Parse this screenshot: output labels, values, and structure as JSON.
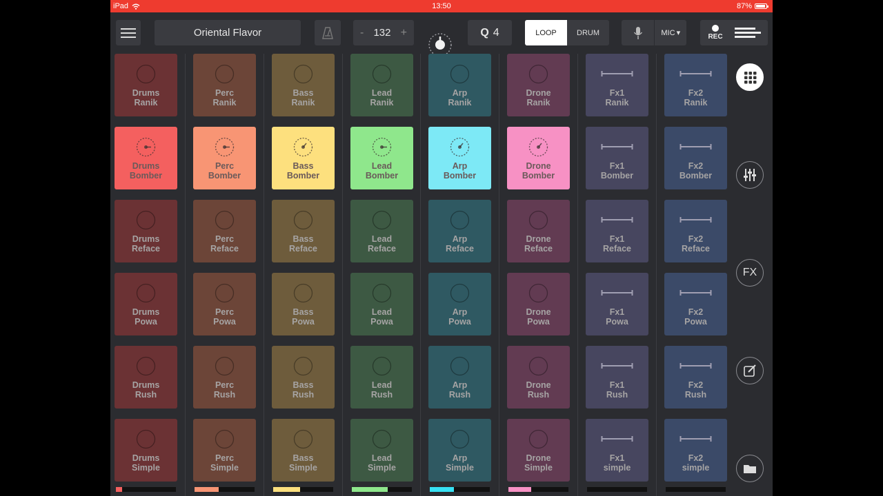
{
  "status_bar": {
    "device": "iPad",
    "time": "13:50",
    "battery": "87%"
  },
  "toolbar": {
    "project_title": "Oriental Flavor",
    "tempo": {
      "minus": "-",
      "value": "132",
      "plus": "+"
    },
    "quantize": {
      "label": "Q",
      "value": "4"
    },
    "mode": {
      "loop": "LOOP",
      "drum": "DRUM",
      "selected": "LOOP"
    },
    "input": {
      "label": "MIC",
      "arrow": "▾"
    },
    "record": {
      "label": "REC"
    }
  },
  "columns": [
    {
      "name": "Drums",
      "dim": "#6b3234",
      "active": "#f4605f",
      "level": "#f4605f",
      "level_fill": 0.1
    },
    {
      "name": "Perc",
      "dim": "#6c4538",
      "active": "#f89574",
      "level": "#f89574",
      "level_fill": 0.4
    },
    {
      "name": "Bass",
      "dim": "#6e5c3c",
      "active": "#fde07e",
      "level": "#fde07e",
      "level_fill": 0.45
    },
    {
      "name": "Lead",
      "dim": "#3d5943",
      "active": "#8fe78c",
      "level": "#8fe78c",
      "level_fill": 0.6
    },
    {
      "name": "Arp",
      "dim": "#2f5962",
      "active": "#7de9f6",
      "level": "#37e1f4",
      "level_fill": 0.4
    },
    {
      "name": "Drone",
      "dim": "#623b52",
      "active": "#f791c4",
      "level": "#f791c4",
      "level_fill": 0.38
    },
    {
      "name": "Fx1",
      "dim": "#47465f",
      "active": "#47465f",
      "level": "#555",
      "level_fill": 0
    },
    {
      "name": "Fx2",
      "dim": "#3b4a68",
      "active": "#3b4a68",
      "level": "#555",
      "level_fill": 0
    }
  ],
  "rows": [
    {
      "name": "Ranik",
      "labels": [
        "Drums\nRanik",
        "Perc\nRanik",
        "Bass\nRanik",
        "Lead\nRanik",
        "Arp\nRanik",
        "Drone\nRanik",
        "Fx1\nRanik",
        "Fx2\nRanik"
      ]
    },
    {
      "name": "Bomber",
      "active": true,
      "labels": [
        "Drums\nBomber",
        "Perc\nBomber",
        "Bass\nBomber",
        "Lead\nBomber",
        "Arp\nBomber",
        "Drone\nBomber",
        "Fx1\nBomber",
        "Fx2\nBomber"
      ]
    },
    {
      "name": "Reface",
      "labels": [
        "Drums\nReface",
        "Perc\nReface",
        "Bass\nReface",
        "Lead\nReface",
        "Arp\nReface",
        "Drone\nReface",
        "Fx1\nReface",
        "Fx2\nReface"
      ]
    },
    {
      "name": "Powa",
      "labels": [
        "Drums\nPowa",
        "Perc\nPowa",
        "Bass\nPowa",
        "Lead\nPowa",
        "Arp\nPowa",
        "Drone\nPowa",
        "Fx1\nPowa",
        "Fx2\nPowa"
      ]
    },
    {
      "name": "Rush",
      "labels": [
        "Drums\nRush",
        "Perc\nRush",
        "Bass\nRush",
        "Lead\nRush",
        "Arp\nRush",
        "Drone\nRush",
        "Fx1\nRush",
        "Fx2\nRush"
      ]
    },
    {
      "name": "Simple",
      "labels": [
        "Drums\nSimple",
        "Perc\nSimple",
        "Bass\nSimple",
        "Lead\nSimple",
        "Arp\nSimple",
        "Drone\nSimple",
        "Fx1\nsimple",
        "Fx2\nsimple"
      ]
    }
  ],
  "sidebar": {
    "fx_label": "FX",
    "icons": [
      "grid-icon",
      "mixer-icon",
      "fx-icon",
      "edit-icon",
      "folder-icon"
    ]
  }
}
